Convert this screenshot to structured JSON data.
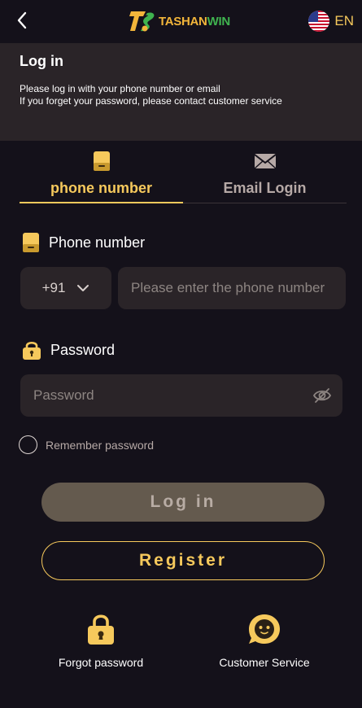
{
  "topbar": {
    "logo_icon": "TS",
    "logo_text_a": "TASHAN",
    "logo_text_b": "WIN",
    "language": "EN"
  },
  "header": {
    "title": "Log in",
    "line1": "Please log in with your phone number or email",
    "line2": "If you forget your password, please contact customer service"
  },
  "tabs": [
    {
      "label": "phone number",
      "icon": "phone-icon",
      "active": true
    },
    {
      "label": "Email Login",
      "icon": "mail-icon",
      "active": false
    }
  ],
  "phone": {
    "label": "Phone number",
    "country_code": "+91",
    "placeholder": "Please enter the phone number"
  },
  "password": {
    "label": "Password",
    "placeholder": "Password"
  },
  "remember": {
    "label": "Remember password"
  },
  "buttons": {
    "login": "Log in",
    "register": "Register"
  },
  "bottom": {
    "forgot": "Forgot password",
    "service": "Customer Service"
  },
  "colors": {
    "background": "#14111a",
    "panel": "#2a2428",
    "accent": "#f6c95c",
    "login_button": "#645a4e"
  }
}
